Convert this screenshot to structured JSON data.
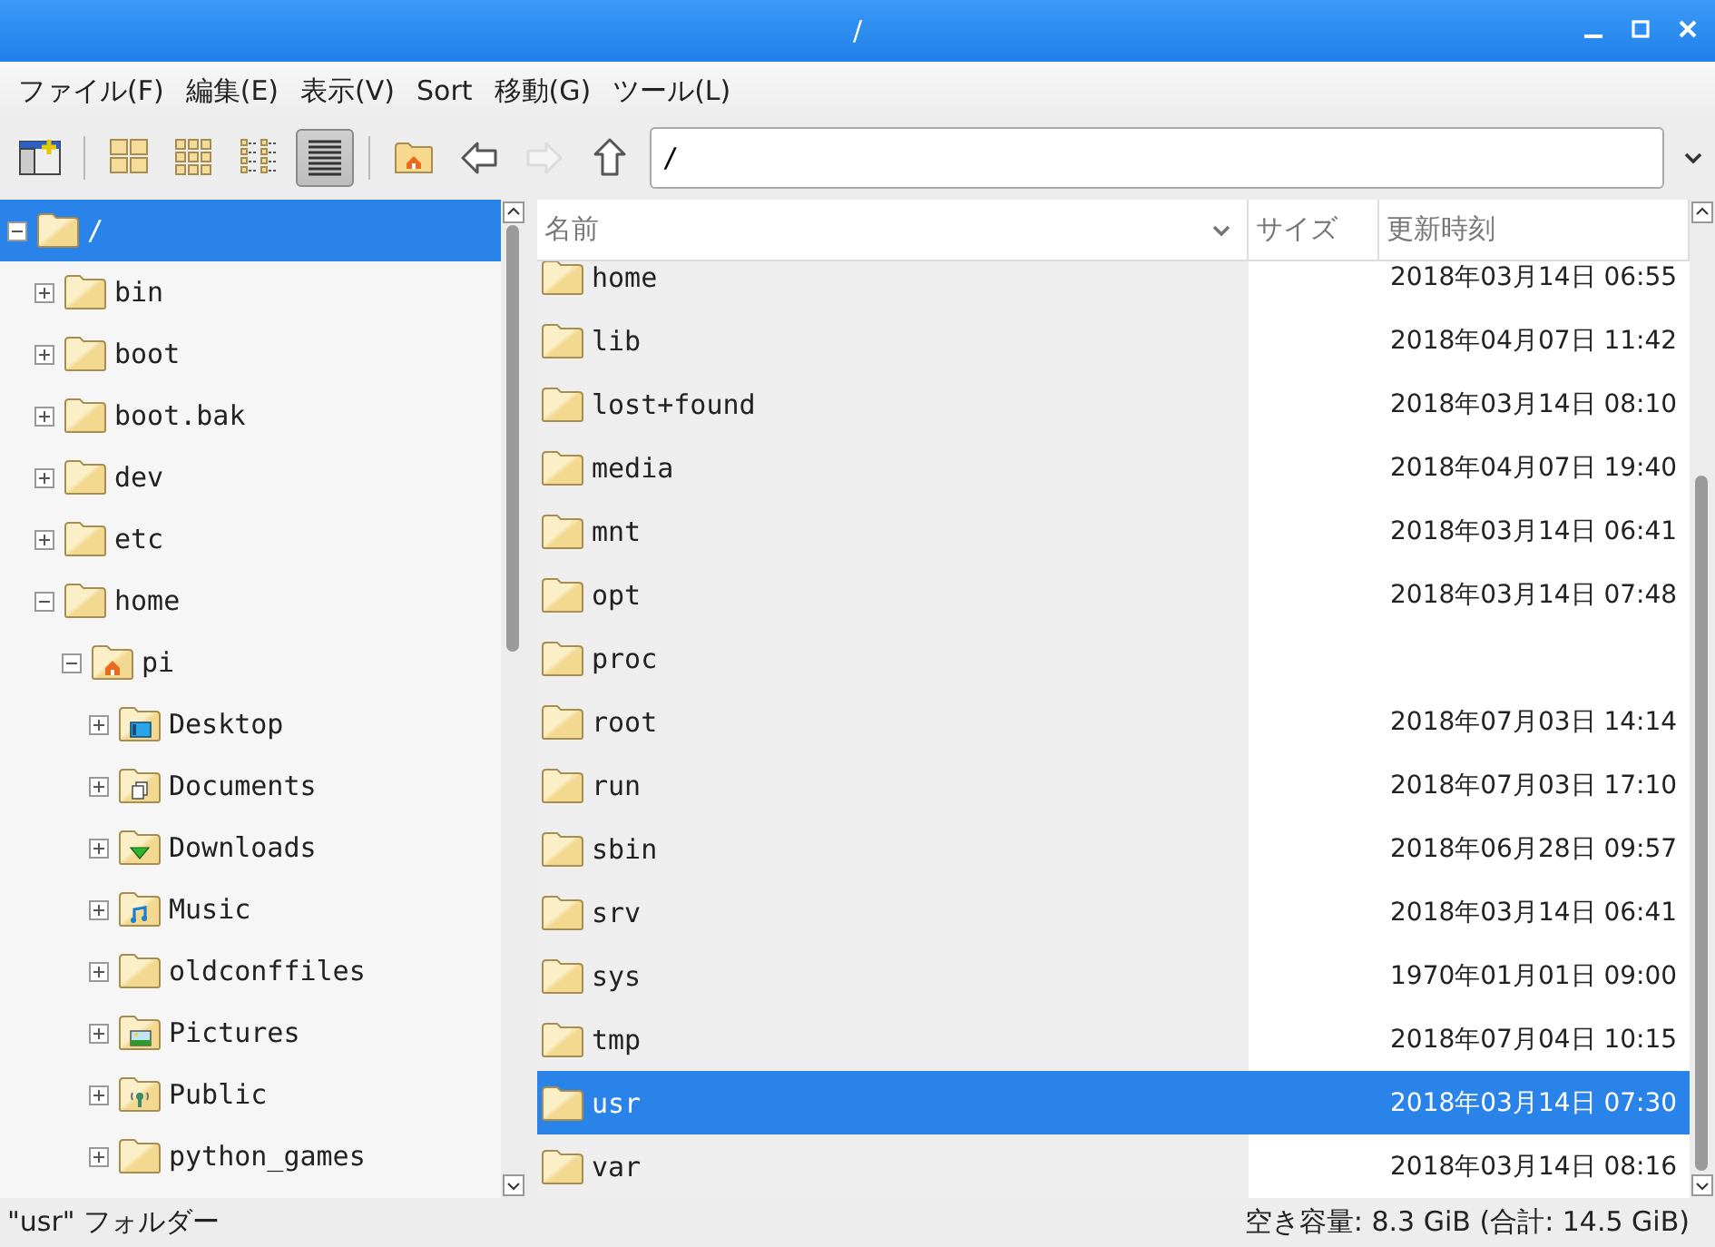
{
  "window": {
    "title": "/"
  },
  "menu": [
    "ファイル(F)",
    "編集(E)",
    "表示(V)",
    "Sort",
    "移動(G)",
    "ツール(L)"
  ],
  "view_buttons": [
    {
      "kind": "icons",
      "selected": false
    },
    {
      "kind": "thumbnails",
      "selected": false
    },
    {
      "kind": "compact",
      "selected": false
    },
    {
      "kind": "detailed",
      "selected": true
    }
  ],
  "nav_buttons": [
    {
      "kind": "home",
      "disabled": false
    },
    {
      "kind": "back",
      "disabled": false
    },
    {
      "kind": "forward",
      "disabled": true
    },
    {
      "kind": "up",
      "disabled": false
    }
  ],
  "location": {
    "value": "/"
  },
  "tree": [
    {
      "label": "/",
      "kind": "plain",
      "expanded": true,
      "selected": true,
      "children": [
        {
          "label": "bin",
          "kind": "plain",
          "expanded": false,
          "selected": false
        },
        {
          "label": "boot",
          "kind": "plain",
          "expanded": false,
          "selected": false
        },
        {
          "label": "boot.bak",
          "kind": "plain",
          "expanded": false,
          "selected": false
        },
        {
          "label": "dev",
          "kind": "plain",
          "expanded": false,
          "selected": false
        },
        {
          "label": "etc",
          "kind": "plain",
          "expanded": false,
          "selected": false
        },
        {
          "label": "home",
          "kind": "plain",
          "expanded": true,
          "selected": false,
          "children": [
            {
              "label": "pi",
              "kind": "home",
              "expanded": true,
              "selected": false,
              "children": [
                {
                  "label": "Desktop",
                  "kind": "desktop",
                  "expanded": false,
                  "selected": false
                },
                {
                  "label": "Documents",
                  "kind": "documents",
                  "expanded": false,
                  "selected": false
                },
                {
                  "label": "Downloads",
                  "kind": "downloads",
                  "expanded": false,
                  "selected": false
                },
                {
                  "label": "Music",
                  "kind": "music",
                  "expanded": false,
                  "selected": false
                },
                {
                  "label": "oldconffiles",
                  "kind": "plain",
                  "expanded": false,
                  "selected": false
                },
                {
                  "label": "Pictures",
                  "kind": "pictures",
                  "expanded": false,
                  "selected": false
                },
                {
                  "label": "Public",
                  "kind": "public",
                  "expanded": false,
                  "selected": false
                },
                {
                  "label": "python_games",
                  "kind": "plain",
                  "expanded": false,
                  "selected": false
                }
              ]
            }
          ]
        }
      ]
    }
  ],
  "table": {
    "columns": [
      "名前",
      "サイズ",
      "更新時刻"
    ],
    "rows": [
      {
        "name": "home",
        "modified": "2018年03月14日 06:55",
        "selected": false
      },
      {
        "name": "lib",
        "modified": "2018年04月07日 11:42",
        "selected": false
      },
      {
        "name": "lost+found",
        "modified": "2018年03月14日 08:10",
        "selected": false
      },
      {
        "name": "media",
        "modified": "2018年04月07日 19:40",
        "selected": false
      },
      {
        "name": "mnt",
        "modified": "2018年03月14日 06:41",
        "selected": false
      },
      {
        "name": "opt",
        "modified": "2018年03月14日 07:48",
        "selected": false
      },
      {
        "name": "proc",
        "selected": false
      },
      {
        "name": "root",
        "modified": "2018年07月03日 14:14",
        "selected": false
      },
      {
        "name": "run",
        "modified": "2018年07月03日 17:10",
        "selected": false
      },
      {
        "name": "sbin",
        "modified": "2018年06月28日 09:57",
        "selected": false
      },
      {
        "name": "srv",
        "modified": "2018年03月14日 06:41",
        "selected": false
      },
      {
        "name": "sys",
        "modified": "1970年01月01日 09:00",
        "selected": false
      },
      {
        "name": "tmp",
        "modified": "2018年07月04日 10:15",
        "selected": false
      },
      {
        "name": "usr",
        "modified": "2018年03月14日 07:30",
        "selected": true
      },
      {
        "name": "var",
        "modified": "2018年03月14日 08:16",
        "selected": false
      }
    ]
  },
  "status_bar": {
    "left": "\"usr\" フォルダー",
    "right": "空き容量: 8.3 GiB (合計: 14.5 GiB)"
  }
}
